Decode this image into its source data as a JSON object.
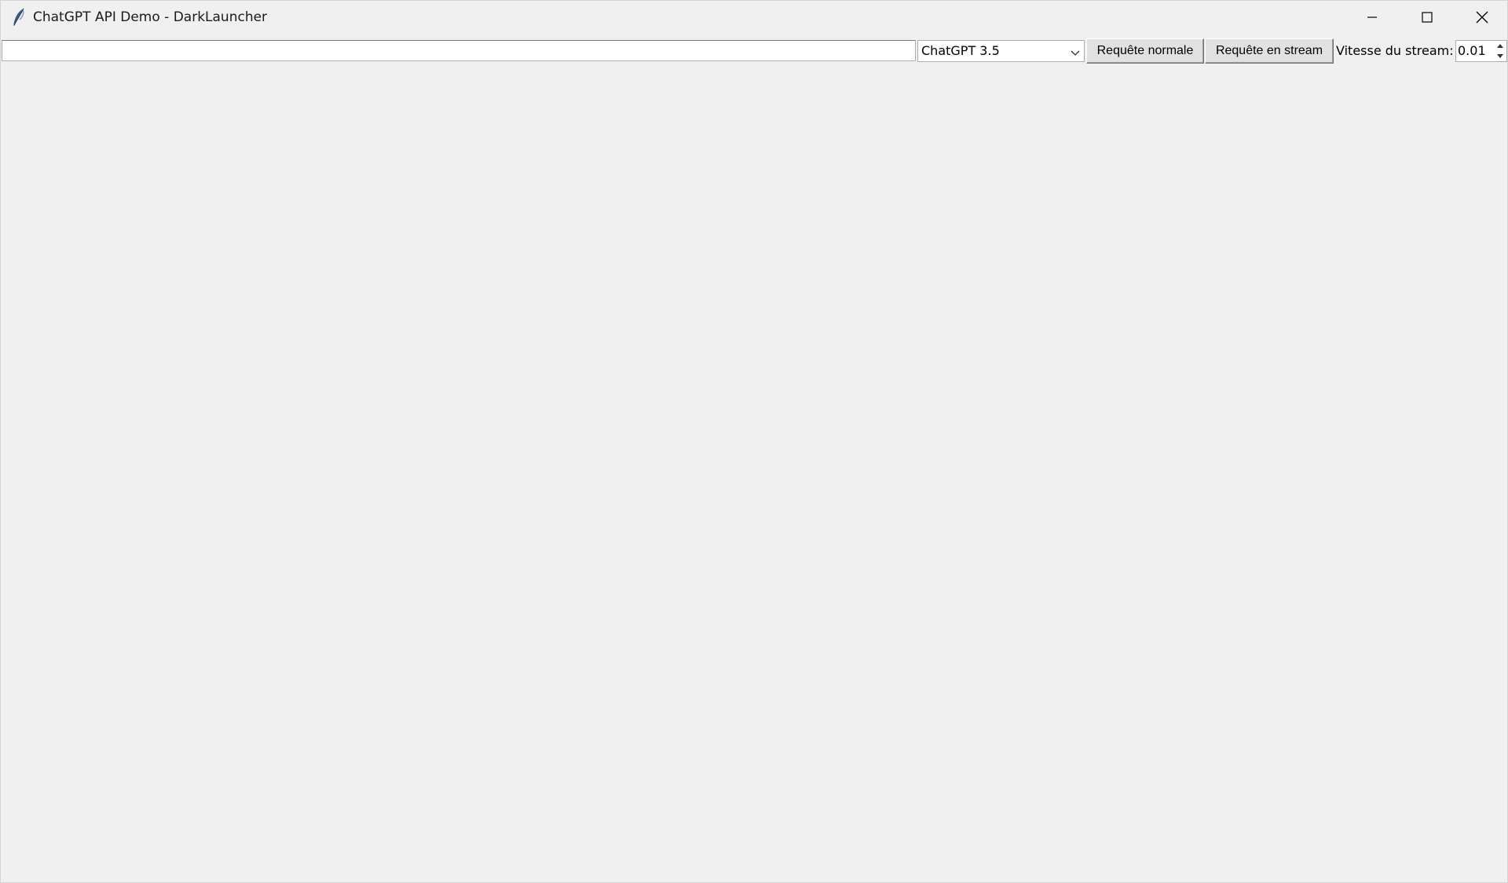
{
  "window": {
    "title": "ChatGPT API Demo - DarkLauncher",
    "app_icon": "feather-icon",
    "controls": [
      "minimize-icon",
      "maximize-icon",
      "close-icon"
    ]
  },
  "toolbar": {
    "prompt": {
      "value": "",
      "placeholder": ""
    },
    "model_select": {
      "selected": "ChatGPT 3.5"
    },
    "normal_button_label": "Requête normale",
    "stream_button_label": "Requête en stream",
    "speed_label": "Vitesse du stream:",
    "speed_value": "0.01"
  },
  "colors": {
    "background": "#f0f0f0",
    "field_background": "#ffffff",
    "button_face": "#e1e1e1"
  }
}
